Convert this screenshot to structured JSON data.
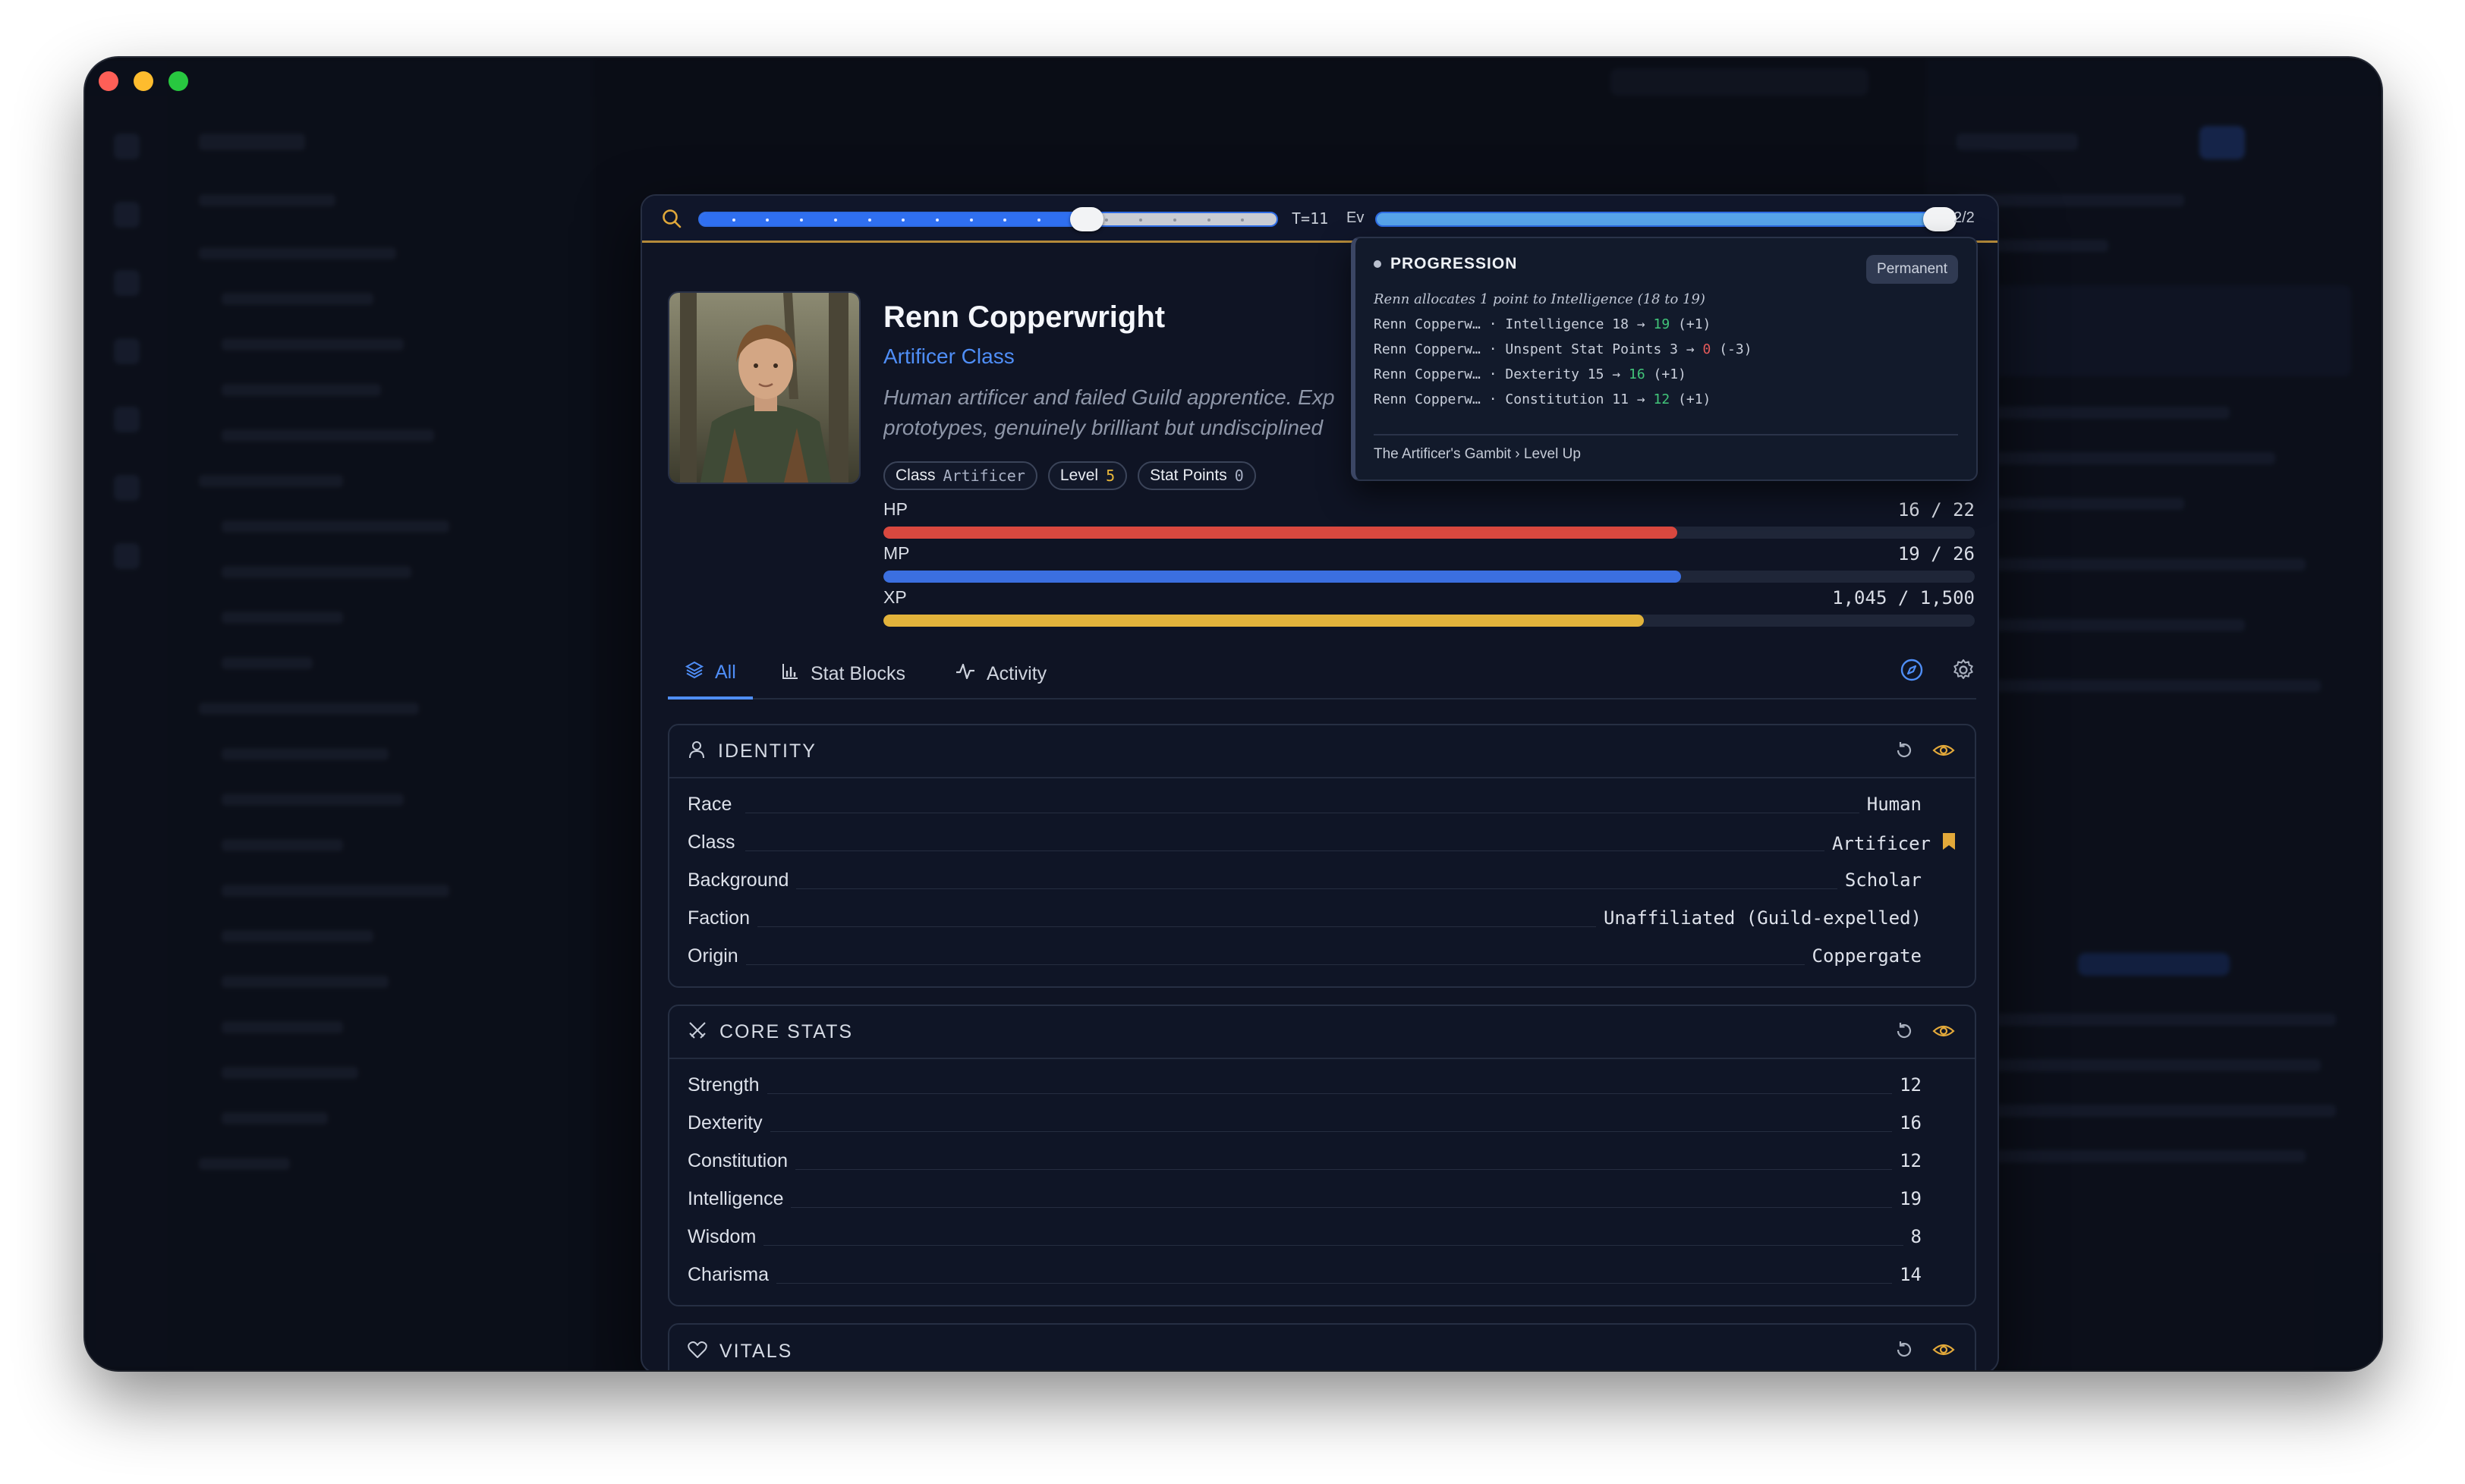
{
  "scrubber": {
    "time_label": "T=11",
    "event_label": "Ev",
    "event_count": "2/2",
    "timeline_position": 0.67,
    "event_position": 1.0
  },
  "character": {
    "name": "Renn Copperwright",
    "class_title": "Artificer Class",
    "description": "Human artificer and failed Guild apprentice. Exp… prototypes, genuinely brilliant but undisciplined",
    "description_line1": "Human artificer and failed Guild apprentice. Exp",
    "description_line2": "prototypes, genuinely brilliant but undisciplined",
    "chips": [
      {
        "label": "Class",
        "value": "Artificer"
      },
      {
        "label": "Level",
        "value": "5"
      },
      {
        "label": "Stat Points",
        "value": "0"
      }
    ]
  },
  "bars": {
    "hp": {
      "label": "HP",
      "text": "16 / 22",
      "current": 16,
      "max": 22,
      "color": "#d9483f"
    },
    "mp": {
      "label": "MP",
      "text": "19 / 26",
      "current": 19,
      "max": 26,
      "color": "#3b6fe0"
    },
    "xp": {
      "label": "XP",
      "text": "1,045 / 1,500",
      "current": 1045,
      "max": 1500,
      "color": "#e2b33b"
    }
  },
  "tabs": [
    {
      "label": "All",
      "icon": "layers-icon",
      "active": true
    },
    {
      "label": "Stat Blocks",
      "icon": "bar-chart-icon",
      "active": false
    },
    {
      "label": "Activity",
      "icon": "activity-icon",
      "active": false
    }
  ],
  "identity": {
    "title": "IDENTITY",
    "rows": [
      {
        "key": "Race",
        "value": "Human"
      },
      {
        "key": "Class",
        "value": "Artificer",
        "bookmark": true
      },
      {
        "key": "Background",
        "value": "Scholar"
      },
      {
        "key": "Faction",
        "value": "Unaffiliated (Guild-expelled)"
      },
      {
        "key": "Origin",
        "value": "Coppergate"
      }
    ]
  },
  "core_stats": {
    "title": "CORE STATS",
    "rows": [
      {
        "key": "Strength",
        "value": "12"
      },
      {
        "key": "Dexterity",
        "value": "16"
      },
      {
        "key": "Constitution",
        "value": "12"
      },
      {
        "key": "Intelligence",
        "value": "19"
      },
      {
        "key": "Wisdom",
        "value": "8"
      },
      {
        "key": "Charisma",
        "value": "14"
      }
    ]
  },
  "vitals": {
    "title": "VITALS"
  },
  "progression": {
    "title": "PROGRESSION",
    "badge": "Permanent",
    "note": "Renn allocates 1 point to Intelligence (18 to 19)",
    "rows": [
      {
        "who": "Renn Copperw…",
        "stat": "Intelligence",
        "from": "18",
        "to": "19",
        "delta": "(+1)",
        "dir": "up"
      },
      {
        "who": "Renn Copperw…",
        "stat": "Unspent Stat Points",
        "from": "3",
        "to": "0",
        "delta": "(-3)",
        "dir": "down"
      },
      {
        "who": "Renn Copperw…",
        "stat": "Dexterity",
        "from": "15",
        "to": "16",
        "delta": "(+1)",
        "dir": "up"
      },
      {
        "who": "Renn Copperw…",
        "stat": "Constitution",
        "from": "11",
        "to": "12",
        "delta": "(+1)",
        "dir": "up"
      }
    ],
    "footer": "The Artificer's Gambit › Level Up"
  },
  "colors": {
    "accent": "#4f8ef7",
    "gold": "#e8b73a",
    "panel_bg": "#0f1424",
    "timeline_border": "#b48a3a"
  }
}
